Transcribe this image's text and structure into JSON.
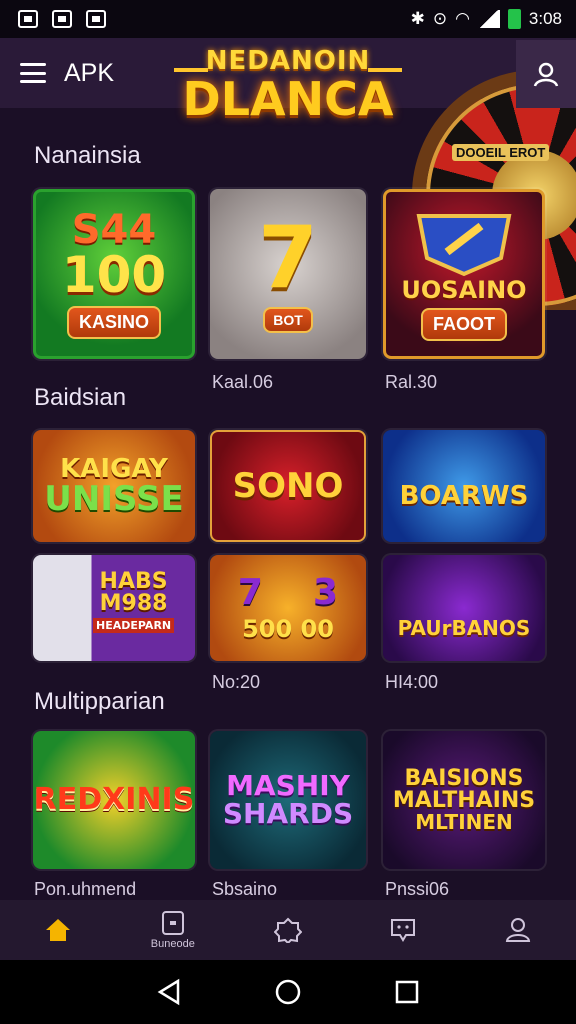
{
  "status_bar": {
    "time": "3:08"
  },
  "header": {
    "app_label": "APK",
    "logo_top": "NEDANOIN",
    "logo_bottom": "DLANCA",
    "wheel_label": "DOOEIL EROT"
  },
  "sections": [
    {
      "title": "Nanainsia"
    },
    {
      "title": "Baidsian"
    },
    {
      "title": "Multipparian"
    }
  ],
  "row1": {
    "cards": [
      {
        "line1": "S44",
        "line2": "100",
        "tag": "KASINO"
      },
      {
        "line1": "7",
        "tag": "BOT"
      },
      {
        "line1": "UOSAINO",
        "tag": "FAOOT"
      }
    ],
    "captions": [
      "",
      "Kaal.06",
      "Ral.30"
    ]
  },
  "row2": {
    "cards": [
      {
        "line1": "KAIGAY",
        "line2": "UNISSE"
      },
      {
        "line1": "SONO"
      },
      {
        "line1": "BOARWS"
      }
    ]
  },
  "row3": {
    "cards": [
      {
        "line1": "HABS",
        "line2": "M988",
        "line3": "HEADEPARN"
      },
      {
        "line1": "7    3",
        "line2": "500 00"
      },
      {
        "line1": "PAUrBANOS"
      }
    ],
    "captions": [
      "",
      "No:20",
      "HI4:00"
    ]
  },
  "row4": {
    "cards": [
      {
        "line1": "REDXINIS"
      },
      {
        "line1": "MASHIY",
        "line2": "SHARDS"
      },
      {
        "line1": "BAISIONS",
        "line2": "MALTHAINS",
        "line3": "MLTINEN"
      }
    ],
    "captions": [
      "Pon.uhmend",
      "Sbsaino",
      "Pnssi06"
    ]
  },
  "bottom_nav": {
    "items": [
      {
        "icon": "home-icon",
        "label": ""
      },
      {
        "icon": "tablet-icon",
        "label": "Buneode"
      },
      {
        "icon": "badge-icon",
        "label": ""
      },
      {
        "icon": "chat-icon",
        "label": ""
      },
      {
        "icon": "profile-icon",
        "label": ""
      }
    ],
    "active_color": "#f5b400"
  }
}
